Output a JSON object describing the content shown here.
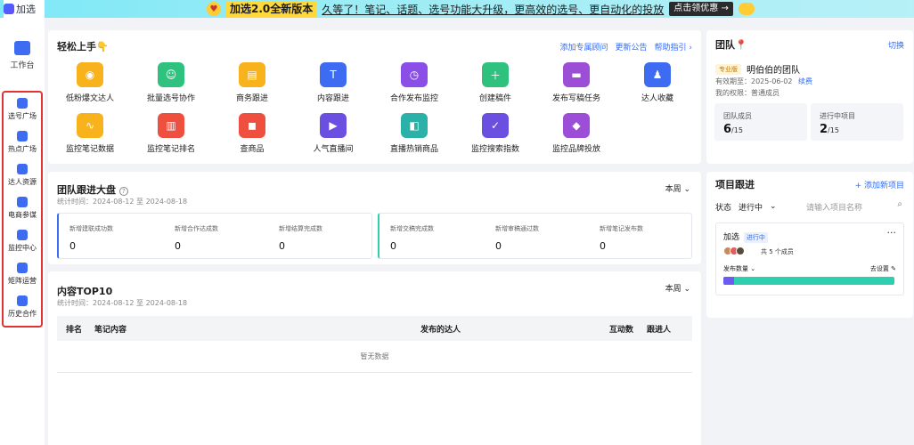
{
  "app": {
    "logo_text": "加选"
  },
  "banner": {
    "version_label": "加选2.0全新版本",
    "headline": "久等了！笔记、话题、选号功能大升级，更高效的选号、更自动化的投放",
    "coupon_button": "点击领优惠 →"
  },
  "sidebar": {
    "top_item": "工作台",
    "items": [
      {
        "label": "选号广场",
        "icon": "users-icon"
      },
      {
        "label": "热点广场",
        "icon": "flame-icon"
      },
      {
        "label": "达人资源",
        "icon": "folder-icon"
      },
      {
        "label": "电商参谋",
        "icon": "bag-icon"
      },
      {
        "label": "监控中心",
        "icon": "chart-icon"
      },
      {
        "label": "矩阵运营",
        "icon": "ai-icon"
      },
      {
        "label": "历史合作",
        "icon": "archive-icon"
      }
    ]
  },
  "quick_start": {
    "title": "轻松上手👇",
    "links": [
      "添加专属顾问",
      "更新公告",
      "帮助指引 ›"
    ],
    "tools": [
      {
        "label": "低粉爆文达人",
        "color": "#f7b21c"
      },
      {
        "label": "批量选号协作",
        "color": "#2ec27e"
      },
      {
        "label": "商务跟进",
        "color": "#f7b21c"
      },
      {
        "label": "内容跟进",
        "color": "#3d6cf2"
      },
      {
        "label": "合作发布监控",
        "color": "#8b4fe8"
      },
      {
        "label": "创建稿件",
        "color": "#2ec27e"
      },
      {
        "label": "发布写稿任务",
        "color": "#9c4fd6"
      },
      {
        "label": "达人收藏",
        "color": "#3d6cf2"
      },
      {
        "label": "监控笔记数据",
        "color": "#f7b21c"
      },
      {
        "label": "监控笔记排名",
        "color": "#ef4f3f"
      },
      {
        "label": "查商品",
        "color": "#ef4f3f"
      },
      {
        "label": "人气直播间",
        "color": "#6a4fe0"
      },
      {
        "label": "直播热销商品",
        "color": "#2bb1a8"
      },
      {
        "label": "监控搜索指数",
        "color": "#6a4fe0"
      },
      {
        "label": "监控品牌投放",
        "color": "#9c4fd6"
      }
    ]
  },
  "team": {
    "title": "团队📍",
    "switch_label": "切换",
    "plan_badge": "专业版",
    "team_name": "明伯伯的团队",
    "expiry": "有效期至：2025-06-02",
    "renew": "续费",
    "role": "我的权限：普通成员",
    "members_label": "团队成员",
    "members_value": "6",
    "members_total": "/15",
    "projects_label": "进行中项目",
    "projects_value": "2",
    "projects_total": "/15"
  },
  "tracking": {
    "title": "团队跟进大盘",
    "period": "本周",
    "stat_time": "统计时间：2024-08-12 至 2024-08-18",
    "metrics_a": [
      {
        "label": "新增建联成功数",
        "value": "0"
      },
      {
        "label": "新增合作达成数",
        "value": "0"
      },
      {
        "label": "新增结算完成数",
        "value": "0"
      }
    ],
    "metrics_b": [
      {
        "label": "新增交稿完成数",
        "value": "0"
      },
      {
        "label": "新增审稿通过数",
        "value": "0"
      },
      {
        "label": "新增笔记发布数",
        "value": "0"
      }
    ]
  },
  "top10": {
    "title": "内容TOP10",
    "period": "本周",
    "stat_time": "统计时间：2024-08-12 至 2024-08-18",
    "columns": [
      "排名",
      "笔记内容",
      "发布的达人",
      "互动数",
      "跟进人"
    ],
    "empty_text": "暂无数据"
  },
  "projects": {
    "title": "项目跟进",
    "add_label": "+ 添加新项目",
    "status_label": "状态",
    "status_value": "进行中",
    "search_placeholder": "请输入项目名称",
    "card": {
      "name": "加选",
      "status": "进行中",
      "members_text": "共 5 个成员",
      "metric_label": "发布数量",
      "settings_label": "去设置",
      "progress_fraction": 0.06
    }
  }
}
